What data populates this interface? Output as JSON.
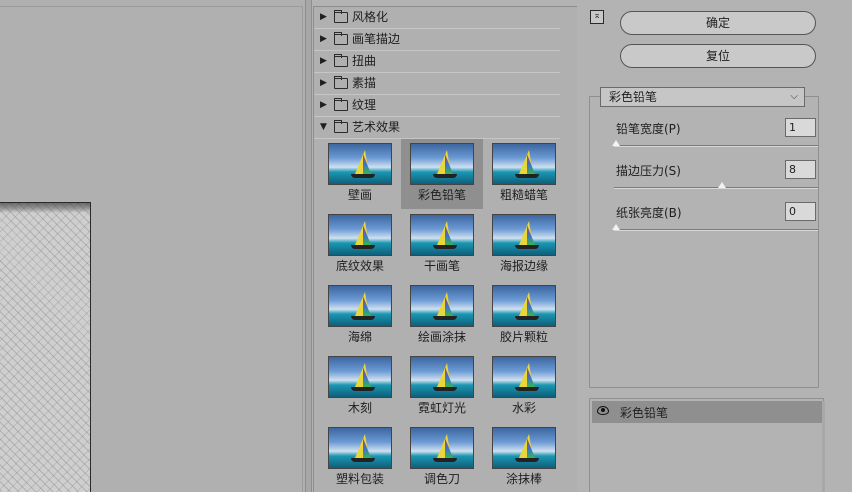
{
  "gallery": {
    "categories": [
      {
        "label": "风格化",
        "expanded": false
      },
      {
        "label": "画笔描边",
        "expanded": false
      },
      {
        "label": "扭曲",
        "expanded": false
      },
      {
        "label": "素描",
        "expanded": false
      },
      {
        "label": "纹理",
        "expanded": false
      },
      {
        "label": "艺术效果",
        "expanded": true
      }
    ],
    "filters": [
      {
        "label": "壁画"
      },
      {
        "label": "彩色铅笔",
        "selected": true
      },
      {
        "label": "粗糙蜡笔"
      },
      {
        "label": "底纹效果"
      },
      {
        "label": "干画笔"
      },
      {
        "label": "海报边缘"
      },
      {
        "label": "海绵"
      },
      {
        "label": "绘画涂抹"
      },
      {
        "label": "胶片颗粒"
      },
      {
        "label": "木刻"
      },
      {
        "label": "霓虹灯光"
      },
      {
        "label": "水彩"
      },
      {
        "label": "塑料包装"
      },
      {
        "label": "调色刀"
      },
      {
        "label": "涂抹棒"
      }
    ]
  },
  "settings": {
    "collapse_icon": "⌅",
    "ok_label": "确定",
    "reset_label": "复位",
    "selected_filter": "彩色铅笔",
    "params": [
      {
        "label": "铅笔宽度(P)",
        "value": "1",
        "fraction": 0.0
      },
      {
        "label": "描边压力(S)",
        "value": "8",
        "fraction": 0.53
      },
      {
        "label": "纸张亮度(B)",
        "value": "0",
        "fraction": 0.0
      }
    ]
  },
  "layers": {
    "items": [
      {
        "label": "彩色铅笔",
        "visible": true
      }
    ]
  },
  "colors": {
    "panel": "#b3b3b3",
    "selected": "#8f8f8f"
  }
}
